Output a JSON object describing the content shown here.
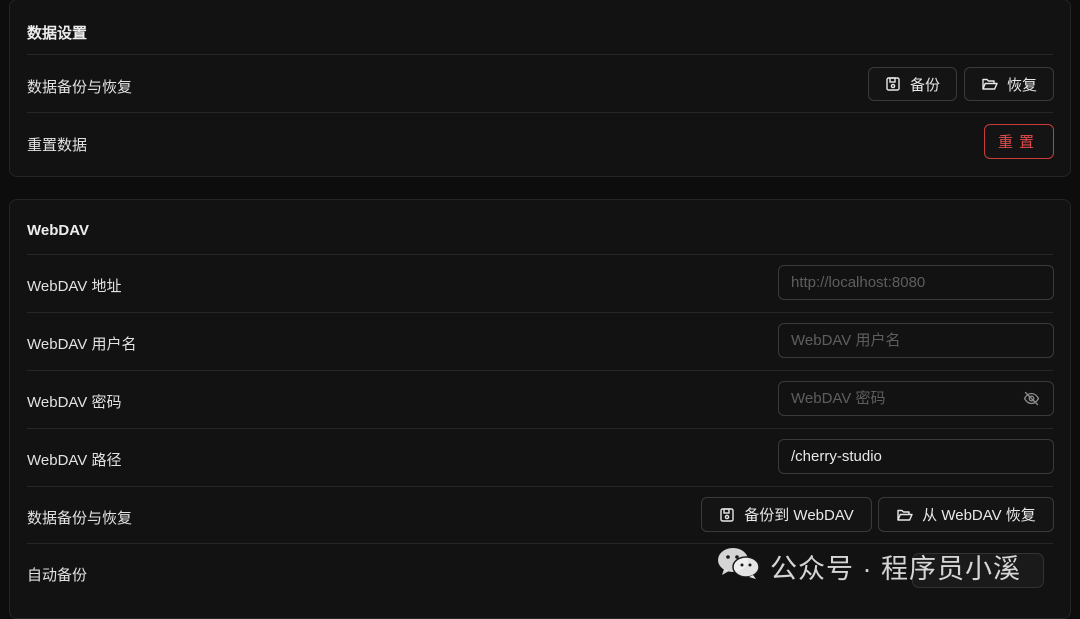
{
  "data_settings": {
    "title": "数据设置",
    "backup_restore_label": "数据备份与恢复",
    "backup_button": "备份",
    "restore_button": "恢复",
    "reset_label": "重置数据",
    "reset_button": "重置"
  },
  "webdav": {
    "title": "WebDAV",
    "address_label": "WebDAV 地址",
    "address_placeholder": "http://localhost:8080",
    "username_label": "WebDAV 用户名",
    "username_placeholder": "WebDAV 用户名",
    "password_label": "WebDAV 密码",
    "password_placeholder": "WebDAV 密码",
    "path_label": "WebDAV 路径",
    "path_value": "/cherry-studio",
    "backup_restore_label": "数据备份与恢复",
    "backup_button": "备份到 WebDAV",
    "restore_button": "从 WebDAV 恢复",
    "auto_backup_label": "自动备份"
  },
  "watermark": {
    "text": "公众号 · 程序员小溪"
  },
  "colors": {
    "danger": "#e04b4b",
    "background": "#0d0d0d",
    "card": "#121212",
    "border": "#3a3a3a"
  }
}
